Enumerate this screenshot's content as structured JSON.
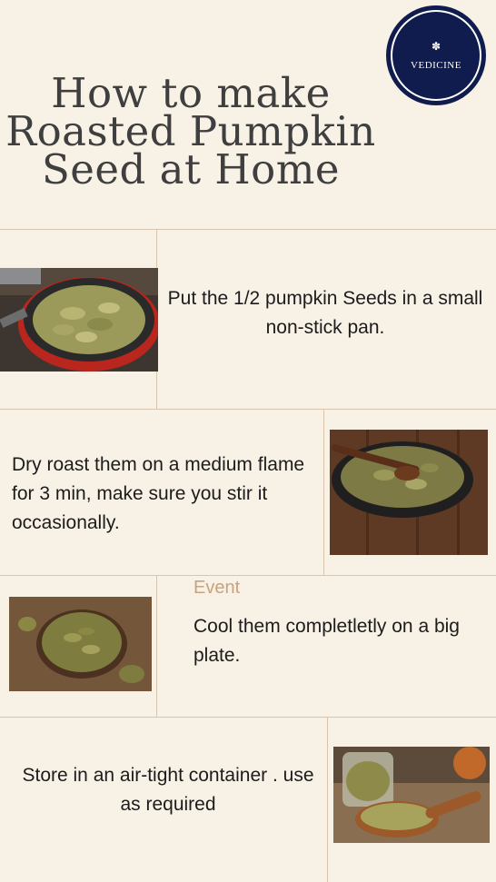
{
  "logo": {
    "name": "VEDICINE"
  },
  "title": {
    "line1": "How to make",
    "line2": "Roasted Pumpkin",
    "line3": "Seed at Home"
  },
  "steps": [
    {
      "text": "Put the 1/2 pumpkin Seeds in a small non-stick pan."
    },
    {
      "text": "Dry roast them on a medium flame for 3 min, make sure you stir it occasionally."
    },
    {
      "label": "Event",
      "text": "Cool them completletly on a big plate."
    },
    {
      "text": "Store in an air-tight container . use as required"
    }
  ],
  "icons": [
    "lotus-icon"
  ],
  "colors": {
    "background": "#f8f1e6",
    "logo": "#0f1c4d",
    "divider": "#d9c5ad",
    "event_label": "#c9a27e"
  }
}
